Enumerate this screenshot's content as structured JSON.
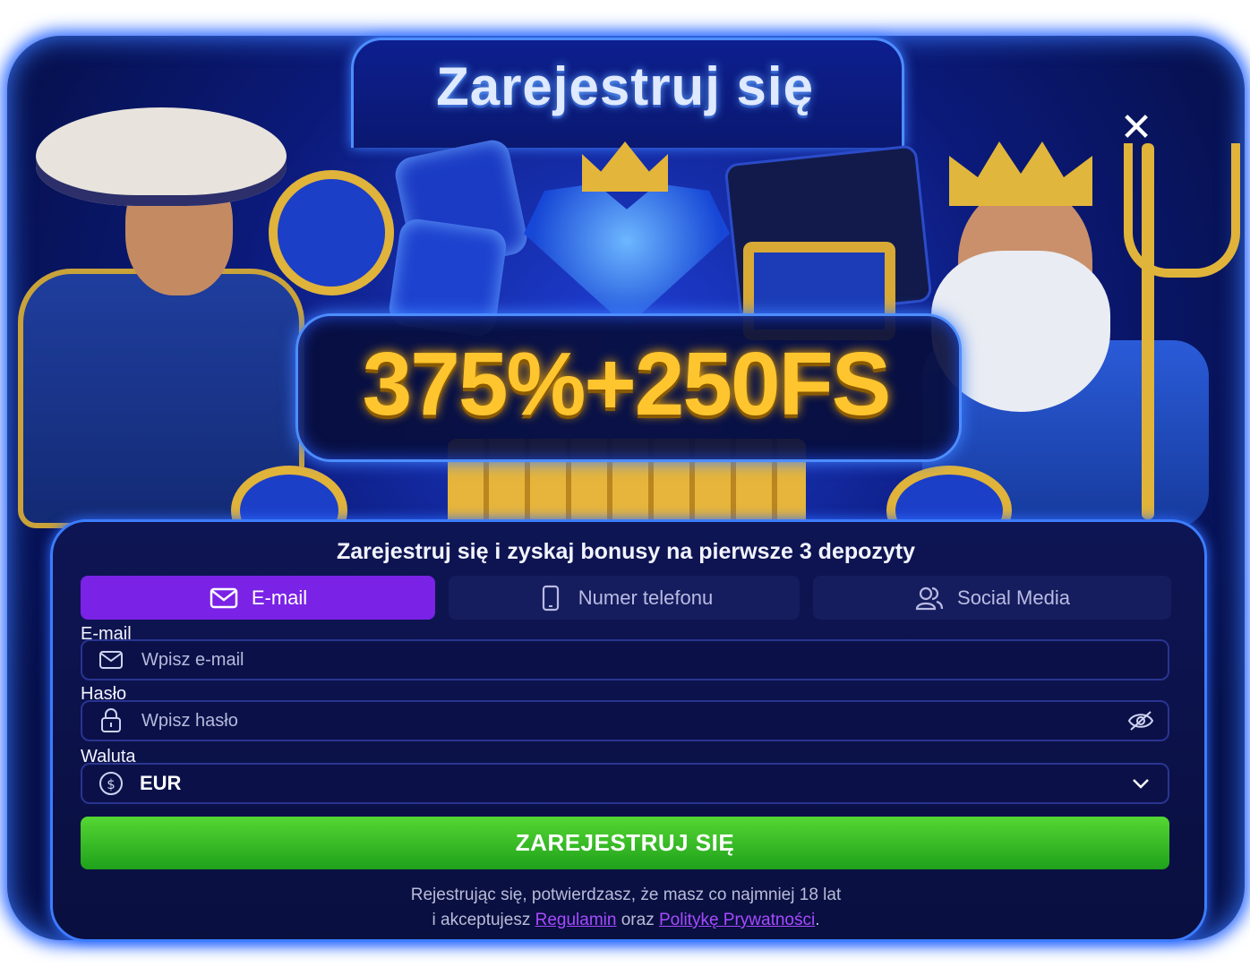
{
  "modal": {
    "title": "Zarejestruj się",
    "close_label": "✕",
    "bonus": "375%+250FS",
    "subtitle": "Zarejestruj się i zyskaj bonusy na pierwsze 3 depozyty"
  },
  "tabs": [
    {
      "label": "E-mail",
      "icon": "mail-icon",
      "active": true
    },
    {
      "label": "Numer telefonu",
      "icon": "phone-icon",
      "active": false
    },
    {
      "label": "Social Media",
      "icon": "users-icon",
      "active": false
    }
  ],
  "form": {
    "email_label": "E-mail",
    "email_placeholder": "Wpisz e-mail",
    "password_label": "Hasło",
    "password_placeholder": "Wpisz hasło",
    "currency_label": "Waluta",
    "currency_value": "EUR"
  },
  "submit_label": "ZAREJESTRUJ SIĘ",
  "legal": {
    "line1": "Rejestrując się, potwierdzasz, że masz co najmniej 18 lat",
    "line2_prefix": "i akceptujesz",
    "terms_link": "Regulamin",
    "connector": "oraz",
    "privacy_link": "Politykę Prywatności",
    "suffix": "."
  },
  "colors": {
    "accent_purple": "#7a22e6",
    "submit_green": "#2fb824",
    "bonus_gold": "#ffc52e",
    "frame_blue": "#3c7dff"
  }
}
